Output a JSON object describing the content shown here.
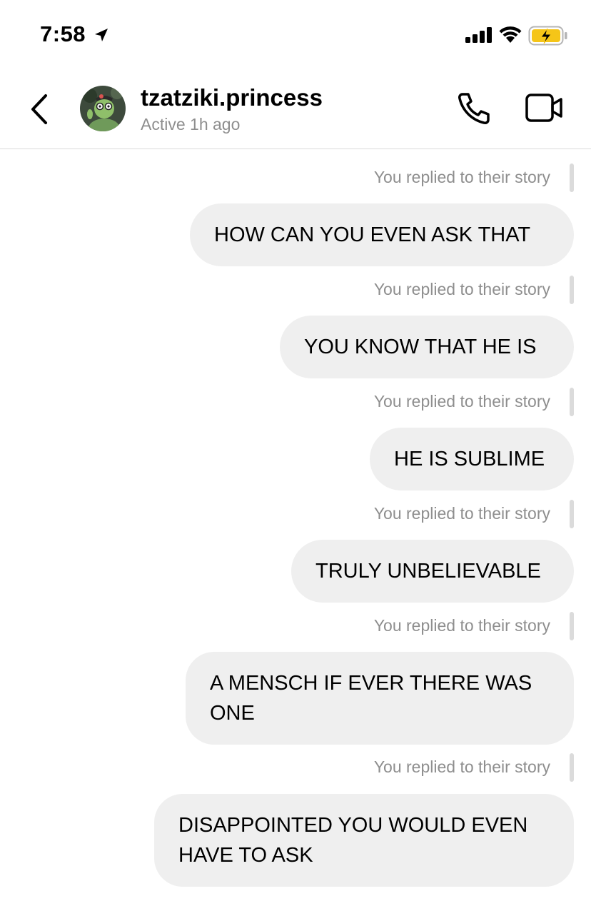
{
  "status_bar": {
    "time": "7:58",
    "location_icon": "location-arrow-icon",
    "signal_icon": "cellular-signal-icon",
    "wifi_icon": "wifi-icon",
    "battery_icon": "battery-charging-icon",
    "battery_color": "#f5c518"
  },
  "header": {
    "back_icon": "chevron-left-icon",
    "username": "tzatziki.princess",
    "active_status": "Active 1h ago",
    "call_icon": "phone-icon",
    "video_icon": "video-camera-icon"
  },
  "messages": [
    {
      "reply_label": "You replied to their story",
      "text": "HOW CAN YOU EVEN ASK THAT"
    },
    {
      "reply_label": "You replied to their story",
      "text": "YOU KNOW THAT HE IS"
    },
    {
      "reply_label": "You replied to their story",
      "text": "HE IS SUBLIME"
    },
    {
      "reply_label": "You replied to their story",
      "text": "TRULY UNBELIEVABLE"
    },
    {
      "reply_label": "You replied to their story",
      "text": "A MENSCH IF EVER THERE WAS ONE"
    },
    {
      "reply_label": "You replied to their story",
      "text": "DISAPPOINTED YOU WOULD EVEN HAVE TO ASK"
    }
  ],
  "colors": {
    "bubble_bg": "#efefef",
    "muted_text": "#8e8e8e",
    "divider": "#dbdbdb"
  }
}
